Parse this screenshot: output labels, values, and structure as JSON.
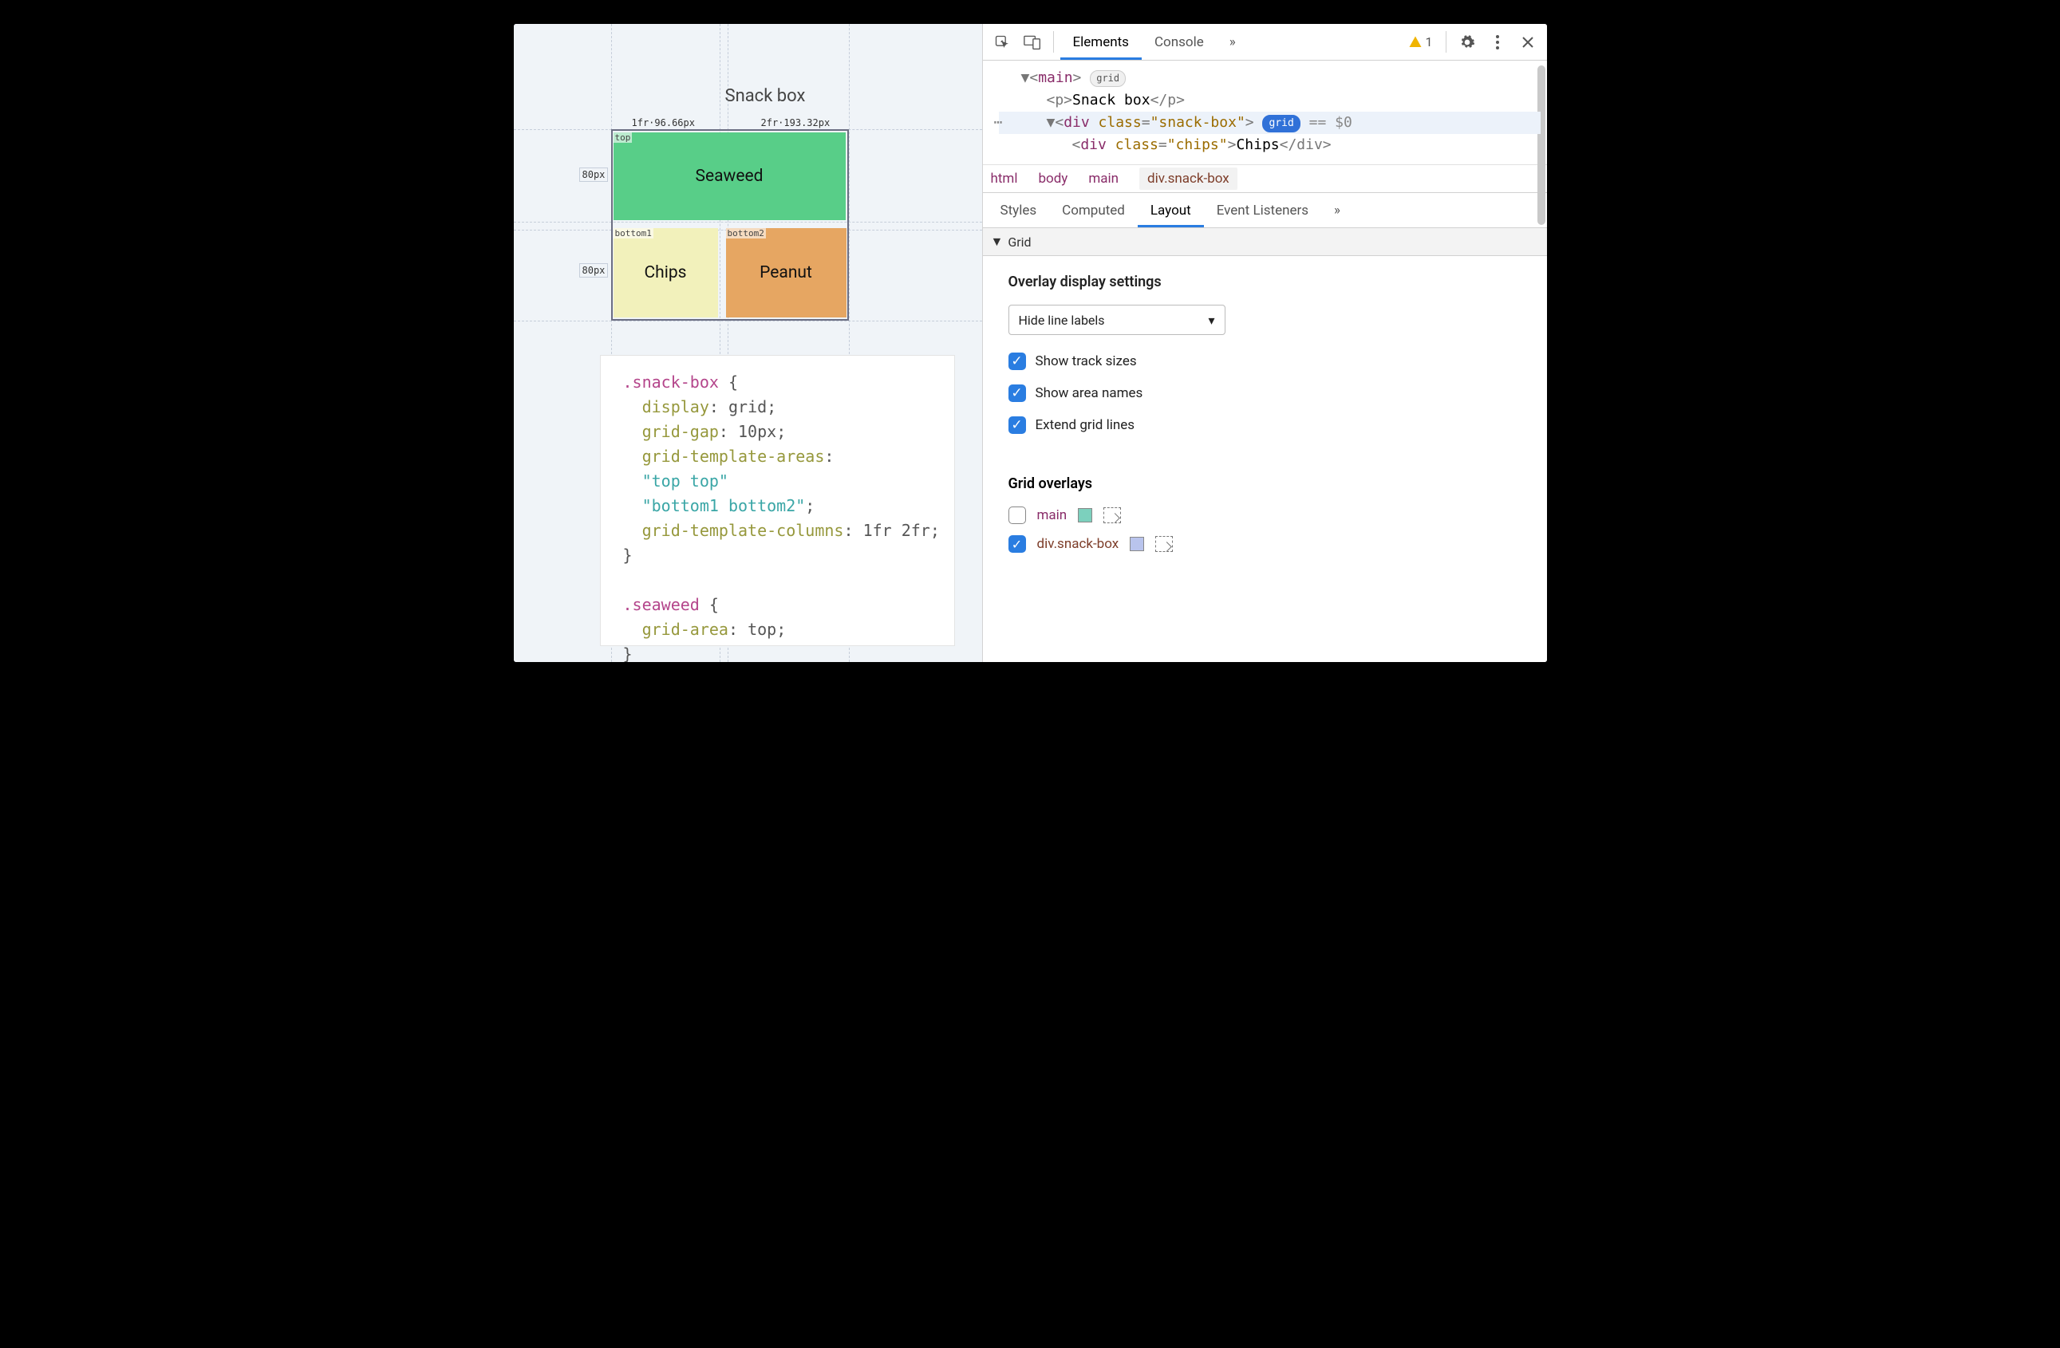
{
  "page": {
    "title": "Snack box",
    "col_labels": [
      "1fr·96.66px",
      "2fr·193.32px"
    ],
    "row_labels": [
      "80px",
      "80px"
    ],
    "areas": {
      "top": {
        "name": "top",
        "content": "Seaweed"
      },
      "bottom1": {
        "name": "bottom1",
        "content": "Chips"
      },
      "bottom2": {
        "name": "bottom2",
        "content": "Peanut"
      }
    }
  },
  "css_snippet": {
    "sel1": ".snack-box",
    "d1": "display",
    "v1": "grid",
    "d2": "grid-gap",
    "v2": "10px",
    "d3": "grid-template-areas",
    "s1": "\"top top\"",
    "s2": "\"bottom1 bottom2\"",
    "d4": "grid-template-columns",
    "v4": "1fr 2fr",
    "sel2": ".seaweed",
    "d5": "grid-area",
    "v5": "top"
  },
  "devtools": {
    "tabs": {
      "elements": "Elements",
      "console": "Console"
    },
    "warn_count": "1",
    "dom": {
      "main": "main",
      "grid_badge": "grid",
      "p_open": "<p>",
      "p_text": "Snack box",
      "p_close": "</p>",
      "div_open": "div",
      "class_attr": "class",
      "snack_val": "\"snack-box\"",
      "eq0": "== $0",
      "grid_badge2": "grid",
      "chips_open": "div",
      "chips_class": "\"chips\"",
      "chips_text": "Chips"
    },
    "crumbs": [
      "html",
      "body",
      "main",
      "div.snack-box"
    ],
    "subtabs": {
      "styles": "Styles",
      "computed": "Computed",
      "layout": "Layout",
      "events": "Event Listeners"
    },
    "grid_section": "Grid",
    "overlay_settings": {
      "title": "Overlay display settings",
      "dropdown": "Hide line labels",
      "opt1": "Show track sizes",
      "opt2": "Show area names",
      "opt3": "Extend grid lines"
    },
    "grid_overlays": {
      "title": "Grid overlays",
      "row1": "main",
      "color1": "#7cd0bd",
      "row2": "div.snack-box",
      "color2": "#b9c4ed"
    }
  }
}
